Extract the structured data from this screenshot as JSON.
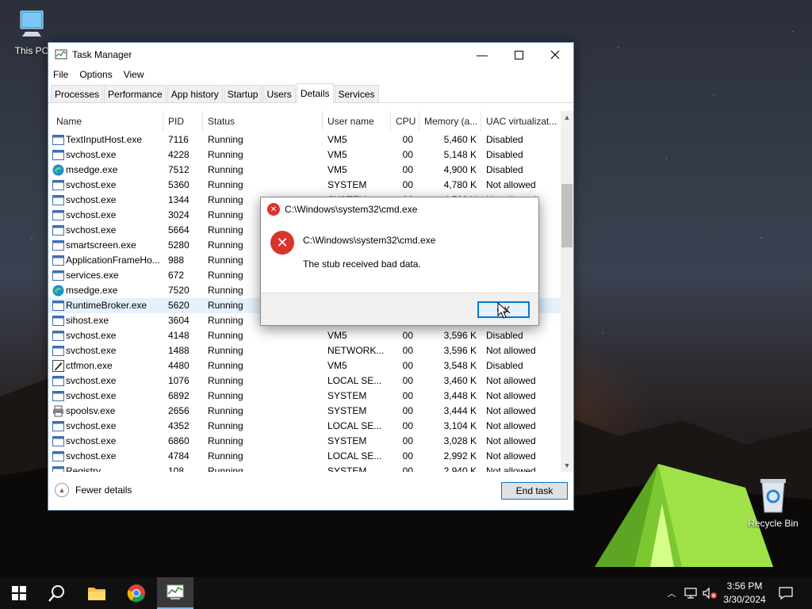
{
  "desktop": {
    "icons": [
      {
        "label": "This PC",
        "icon": "computer-icon"
      },
      {
        "label": "Recycle Bin",
        "icon": "recycle-bin-icon"
      }
    ]
  },
  "task_manager": {
    "title": "Task Manager",
    "menu": [
      "File",
      "Options",
      "View"
    ],
    "tabs": [
      "Processes",
      "Performance",
      "App history",
      "Startup",
      "Users",
      "Details",
      "Services"
    ],
    "active_tab": "Details",
    "columns": [
      "Name",
      "PID",
      "Status",
      "User name",
      "CPU",
      "Memory (a...",
      "UAC virtualizat..."
    ],
    "rows": [
      {
        "name": "TextInputHost.exe",
        "pid": "7116",
        "status": "Running",
        "user": "VM5",
        "cpu": "00",
        "mem": "5,460 K",
        "uac": "Disabled",
        "icon": "app"
      },
      {
        "name": "svchost.exe",
        "pid": "4228",
        "status": "Running",
        "user": "VM5",
        "cpu": "00",
        "mem": "5,148 K",
        "uac": "Disabled",
        "icon": "app"
      },
      {
        "name": "msedge.exe",
        "pid": "7512",
        "status": "Running",
        "user": "VM5",
        "cpu": "00",
        "mem": "4,900 K",
        "uac": "Disabled",
        "icon": "edge"
      },
      {
        "name": "svchost.exe",
        "pid": "5360",
        "status": "Running",
        "user": "SYSTEM",
        "cpu": "00",
        "mem": "4,780 K",
        "uac": "Not allowed",
        "icon": "app"
      },
      {
        "name": "svchost.exe",
        "pid": "1344",
        "status": "Running",
        "user": "SYSTEM",
        "cpu": "00",
        "mem": "4,520 K",
        "uac": "Not allowed",
        "icon": "app"
      },
      {
        "name": "svchost.exe",
        "pid": "3024",
        "status": "Running",
        "user": "",
        "cpu": "",
        "mem": "",
        "uac": "",
        "icon": "app"
      },
      {
        "name": "svchost.exe",
        "pid": "5664",
        "status": "Running",
        "user": "",
        "cpu": "",
        "mem": "",
        "uac": "",
        "icon": "app"
      },
      {
        "name": "smartscreen.exe",
        "pid": "5280",
        "status": "Running",
        "user": "",
        "cpu": "",
        "mem": "",
        "uac": "",
        "icon": "app"
      },
      {
        "name": "ApplicationFrameHo...",
        "pid": "988",
        "status": "Running",
        "user": "",
        "cpu": "",
        "mem": "",
        "uac": "",
        "icon": "app"
      },
      {
        "name": "services.exe",
        "pid": "672",
        "status": "Running",
        "user": "",
        "cpu": "",
        "mem": "",
        "uac": "",
        "icon": "app"
      },
      {
        "name": "msedge.exe",
        "pid": "7520",
        "status": "Running",
        "user": "",
        "cpu": "",
        "mem": "",
        "uac": "",
        "icon": "edge"
      },
      {
        "name": "RuntimeBroker.exe",
        "pid": "5620",
        "status": "Running",
        "user": "",
        "cpu": "",
        "mem": "",
        "uac": "",
        "icon": "app",
        "selected": true
      },
      {
        "name": "sihost.exe",
        "pid": "3604",
        "status": "Running",
        "user": "",
        "cpu": "",
        "mem": "",
        "uac": "",
        "icon": "app"
      },
      {
        "name": "svchost.exe",
        "pid": "4148",
        "status": "Running",
        "user": "VM5",
        "cpu": "00",
        "mem": "3,596 K",
        "uac": "Disabled",
        "icon": "app"
      },
      {
        "name": "svchost.exe",
        "pid": "1488",
        "status": "Running",
        "user": "NETWORK...",
        "cpu": "00",
        "mem": "3,596 K",
        "uac": "Not allowed",
        "icon": "app"
      },
      {
        "name": "ctfmon.exe",
        "pid": "4480",
        "status": "Running",
        "user": "VM5",
        "cpu": "00",
        "mem": "3,548 K",
        "uac": "Disabled",
        "icon": "pen"
      },
      {
        "name": "svchost.exe",
        "pid": "1076",
        "status": "Running",
        "user": "LOCAL SE...",
        "cpu": "00",
        "mem": "3,460 K",
        "uac": "Not allowed",
        "icon": "app"
      },
      {
        "name": "svchost.exe",
        "pid": "6892",
        "status": "Running",
        "user": "SYSTEM",
        "cpu": "00",
        "mem": "3,448 K",
        "uac": "Not allowed",
        "icon": "app"
      },
      {
        "name": "spoolsv.exe",
        "pid": "2656",
        "status": "Running",
        "user": "SYSTEM",
        "cpu": "00",
        "mem": "3,444 K",
        "uac": "Not allowed",
        "icon": "printer"
      },
      {
        "name": "svchost.exe",
        "pid": "4352",
        "status": "Running",
        "user": "LOCAL SE...",
        "cpu": "00",
        "mem": "3,104 K",
        "uac": "Not allowed",
        "icon": "app"
      },
      {
        "name": "svchost.exe",
        "pid": "6860",
        "status": "Running",
        "user": "SYSTEM",
        "cpu": "00",
        "mem": "3,028 K",
        "uac": "Not allowed",
        "icon": "app"
      },
      {
        "name": "svchost.exe",
        "pid": "4784",
        "status": "Running",
        "user": "LOCAL SE...",
        "cpu": "00",
        "mem": "2,992 K",
        "uac": "Not allowed",
        "icon": "app"
      },
      {
        "name": "Registry",
        "pid": "108",
        "status": "Running",
        "user": "SYSTEM",
        "cpu": "00",
        "mem": "2,940 K",
        "uac": "Not allowed",
        "icon": "app"
      }
    ],
    "footer": {
      "fewer_details": "Fewer details",
      "end_task": "End task"
    }
  },
  "dialog": {
    "title": "C:\\Windows\\system32\\cmd.exe",
    "path": "C:\\Windows\\system32\\cmd.exe",
    "message": "The stub received bad data.",
    "ok": "OK"
  },
  "taskbar": {
    "time": "3:56 PM",
    "date": "3/30/2024"
  },
  "colors": {
    "accent": "#0078d7",
    "error": "#d9342b",
    "selection": "#e5f1fb"
  }
}
